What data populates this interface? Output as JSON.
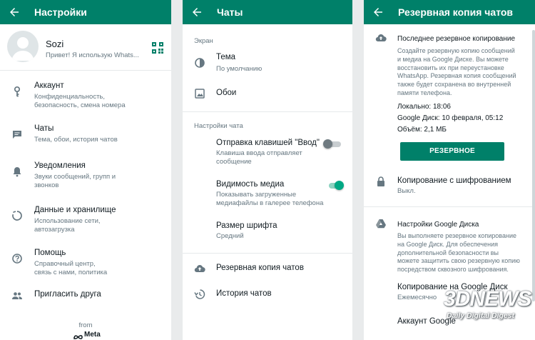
{
  "colors": {
    "accent": "#008069",
    "icon": "#667781",
    "toggle_on": "#00a884"
  },
  "p1": {
    "title": "Настройки",
    "profile": {
      "name": "Sozi",
      "status": "Привет! Я использую Whats..."
    },
    "items": [
      {
        "icon": "key-icon",
        "title": "Аккаунт",
        "sub": "Конфиденциальность,\nбезопасность, смена номера"
      },
      {
        "icon": "chat-icon",
        "title": "Чаты",
        "sub": "Тема, обои, история чатов"
      },
      {
        "icon": "bell-icon",
        "title": "Уведомления",
        "sub": "Звуки сообщений, групп и\nзвонков"
      },
      {
        "icon": "storage-icon",
        "title": "Данные и хранилище",
        "sub": "Использование сети,\nавтозагрузка"
      },
      {
        "icon": "help-icon",
        "title": "Помощь",
        "sub": "Справочный центр,\nсвязь с нами, политика"
      },
      {
        "icon": "people-icon",
        "title": "Пригласить друга",
        "sub": ""
      }
    ],
    "footer": {
      "from": "from",
      "brand": "Meta"
    }
  },
  "p2": {
    "title": "Чаты",
    "section_screen": "Экран",
    "theme": {
      "title": "Тема",
      "sub": "По умолчанию"
    },
    "wallpaper": {
      "title": "Обои"
    },
    "section_chat": "Настройки чата",
    "enter_key": {
      "title": "Отправка клавишей \"Ввод\"",
      "sub": "Клавиша ввода отправляет\nсообщение",
      "on": false
    },
    "media_visibility": {
      "title": "Видимость медиа",
      "sub": "Показывать загруженные\nмедиафайлы в галерее телефона",
      "on": true
    },
    "font_size": {
      "title": "Размер шрифта",
      "sub": "Средний"
    },
    "backup": {
      "title": "Резервная копия чатов"
    },
    "history": {
      "title": "История чатов"
    }
  },
  "p3": {
    "title": "Резервная копия чатов",
    "last_backup": {
      "heading": "Последнее резервное копирование",
      "desc": "Создайте резервную копию сообщений\nи медиа на Google Диске. Вы можете\nвосстановить их при переустановке\nWhatsApp. Резервная копия сообщений\nтакже будет сохранена во внутренней\nпамяти телефона.",
      "local": "Локально: 18:06",
      "gdrive": "Google Диск: 10 февраля, 05:12",
      "size": "Объём: 2,1 МБ",
      "button": "РЕЗЕРВНОЕ КОПИРОВАНИЕ"
    },
    "encryption": {
      "title": "Копирование с шифрованием",
      "sub": "Выкл."
    },
    "gdrive_settings": {
      "heading": "Настройки Google Диска",
      "desc": "Вы выполняете резервное копирование\nна Google Диск. Для обеспечения\nдополнительной безопасности вы\nможете защитить свою резервную копию\nпосредством сквозного шифрования."
    },
    "copy_to_gdrive": {
      "title": "Копирование на Google Диск",
      "sub": "Ежемесячно"
    },
    "account": {
      "title": "Аккаунт Google"
    }
  },
  "watermark": {
    "brand": "3DNEWS",
    "tagline": "Daily Digital Digest"
  }
}
